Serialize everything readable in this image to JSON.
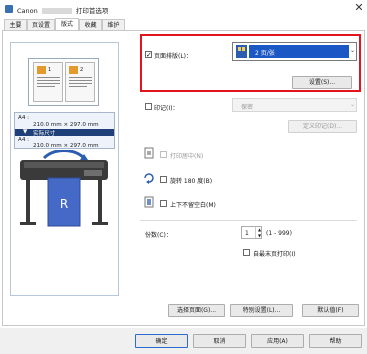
{
  "window": {
    "title_prefix": "Canon",
    "title_suffix": "打印首选项",
    "close_label": "✕"
  },
  "tabs": [
    {
      "label": "主要"
    },
    {
      "label": "页设置"
    },
    {
      "label": "版式"
    },
    {
      "label": "收藏"
    },
    {
      "label": "维护"
    }
  ],
  "preview": {
    "page_numbers": [
      "1",
      "2"
    ],
    "size_line1": "A4 :",
    "size_line2": "210.0 mm × 297.0 mm",
    "size_line3": "实际尺寸",
    "size_line4": "A4 :",
    "size_line5": "210.0 mm × 297.0 mm"
  },
  "layout": {
    "page_layout_label": "页面排版(L)：",
    "page_layout_value": "2 页/张",
    "settings_button": "设置(S)...",
    "stamp_label": "印记(I)：",
    "stamp_value": "保密",
    "define_stamp_button": "定义印记(D)...",
    "center_label": "打印居中(N)",
    "rotate_label": "旋转 180 度(B)",
    "no_margin_label": "上下不留空白(M)",
    "copies_label": "份数(C)：",
    "copies_value": "1",
    "copies_range": "(1 - 999)",
    "reverse_label": "自最末页打印(I)"
  },
  "bottom_buttons": {
    "select_page": "选择页面(G)...",
    "special_settings": "特别设置(L)...",
    "defaults": "默认值(F)"
  },
  "footer": {
    "ok": "确定",
    "cancel": "取消",
    "apply": "应用(A)",
    "help": "帮助"
  },
  "colors": {
    "highlight": "#e3141d",
    "icon_blue": "#2c5db0"
  }
}
